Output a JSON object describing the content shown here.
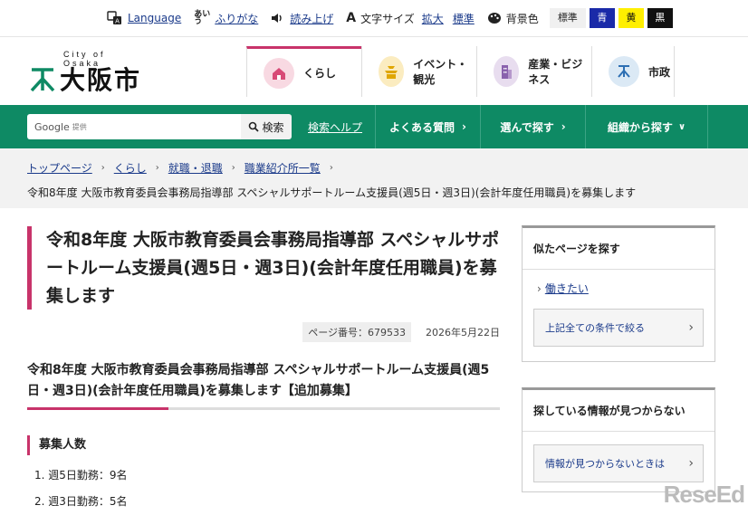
{
  "a11y": {
    "language": "Language",
    "furigana": "ふりがな",
    "yomiage": "読み上げ",
    "font_size_label": "文字サイズ",
    "font_enlarge": "拡大",
    "font_standard": "標準",
    "bg_label": "背景色",
    "bg_standard": "標準",
    "bg_blue": "青",
    "bg_yellow": "黄",
    "bg_black": "黒"
  },
  "logo": {
    "city_of": "City of Osaka",
    "name": "大阪市"
  },
  "gnav": [
    {
      "label": "くらし",
      "icon": "house-icon"
    },
    {
      "label": "イベント・観光",
      "icon": "castle-icon"
    },
    {
      "label": "産業・ビジネス",
      "icon": "building-icon"
    },
    {
      "label": "市政",
      "icon": "city-emblem-icon"
    }
  ],
  "search": {
    "placeholder": "Google",
    "provided": "提供",
    "button": "検索",
    "help": "検索ヘルプ"
  },
  "green_nav": [
    {
      "label": "よくある質問"
    },
    {
      "label": "選んで探す"
    },
    {
      "label": "組織から探す"
    }
  ],
  "breadcrumb": {
    "items": [
      "トップページ",
      "くらし",
      "就職・退職",
      "職業紹介所一覧"
    ],
    "current": "令和8年度 大阪市教育委員会事務局指導部 スペシャルサポートルーム支援員(週5日・週3日)(会計年度任用職員)を募集します"
  },
  "article": {
    "title": "令和8年度 大阪市教育委員会事務局指導部 スペシャルサポートルーム支援員(週5日・週3日)(会計年度任用職員)を募集します",
    "page_no": "ページ番号：679533",
    "date": "2026年5月22日",
    "subtitle": "令和8年度 大阪市教育委員会事務局指導部 スペシャルサポートルーム支援員(週5日・週3日)(会計年度任用職員)を募集します【追加募集】",
    "section": "募集人数",
    "items": [
      "1. 週5日勤務：9名",
      "2. 週3日勤務：5名"
    ]
  },
  "sidebar": {
    "similar_title": "似たページを探す",
    "similar_link": "働きたい",
    "narrow_button": "上記全ての条件で絞る",
    "notfound_title": "探している情報が見つからない",
    "notfound_button": "情報が見つからないときは"
  },
  "watermark": "ReseEd",
  "colors": {
    "green": "#0e8a64",
    "accent": "#c8336a",
    "link": "#1a3a8a"
  }
}
